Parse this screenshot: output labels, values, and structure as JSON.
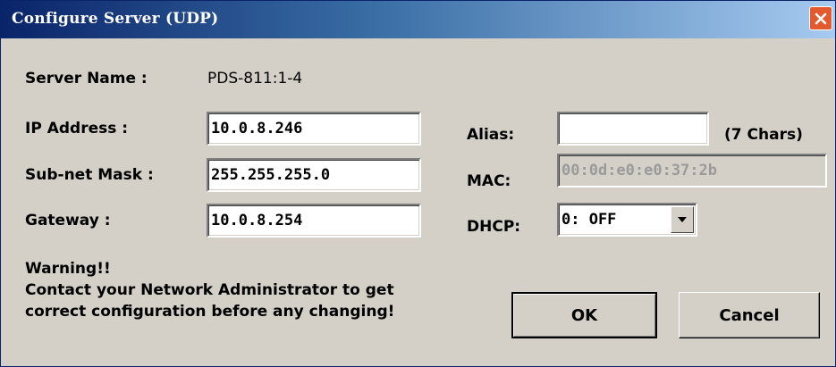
{
  "window": {
    "title": "Configure Server (UDP)",
    "close_icon": "close-icon"
  },
  "server": {
    "name_label": "Server Name :",
    "name_value": "PDS-811:1-4"
  },
  "network": {
    "ip_label": "IP Address :",
    "ip_value": "10.0.8.246",
    "mask_label": "Sub-net Mask :",
    "mask_value": "255.255.255.0",
    "gateway_label": "Gateway :",
    "gateway_value": "10.0.8.254"
  },
  "alias": {
    "label": "Alias:",
    "value": "",
    "hint": "(7 Chars)"
  },
  "mac": {
    "label": "MAC:",
    "value": "00:0d:e0:e0:37:2b"
  },
  "dhcp": {
    "label": "DHCP:",
    "selected": "0: OFF",
    "arrow_icon": "chevron-down-icon"
  },
  "warning": {
    "line1": "Warning!!",
    "line2": "Contact your Network Administrator to get",
    "line3": "correct  configuration before any changing!"
  },
  "buttons": {
    "ok": "OK",
    "cancel": "Cancel"
  },
  "colors": {
    "titlebar_start": "#0a246a",
    "titlebar_end": "#a6caf0",
    "dialog_bg": "#d4d0c8",
    "close_button": "#e35a2f"
  }
}
